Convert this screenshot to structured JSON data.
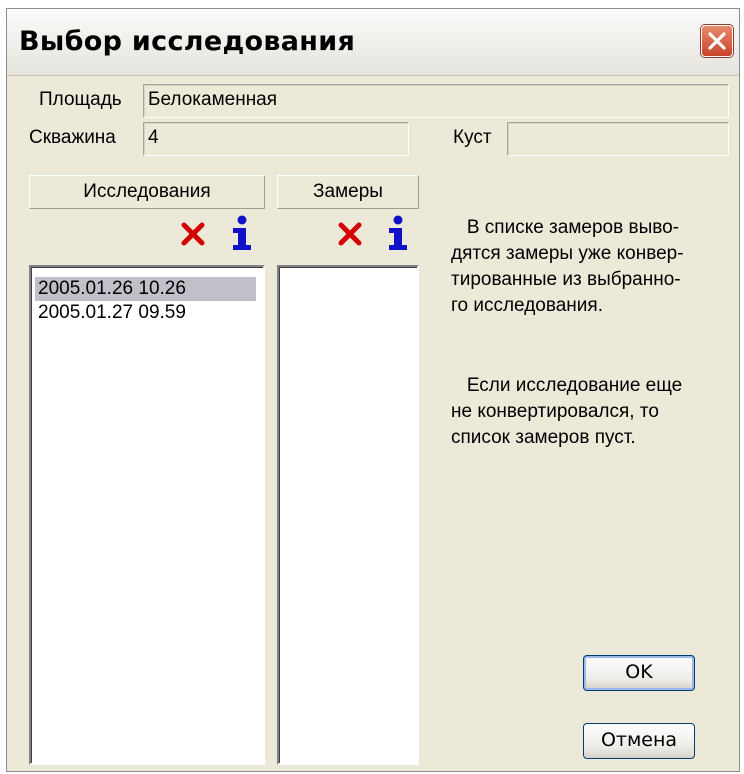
{
  "dialog": {
    "title": "Выбор исследования"
  },
  "fields": {
    "area_label": "Площадь",
    "area_value": "Белокаменная",
    "well_label": "Скважина",
    "well_value": "4",
    "cluster_label": "Куст",
    "cluster_value": ""
  },
  "studies": {
    "header": "Исследования",
    "items": [
      "2005.01.26 10.26",
      "2005.01.27 09.59"
    ],
    "selected_index": 0
  },
  "measurements": {
    "header": "Замеры",
    "items": []
  },
  "help": {
    "paragraph1": "   В списке замеров выво-\nдятся замеры уже конвер-\nтированные из выбранно-\nго исследования.",
    "paragraph2": "   Если исследование еще\nне конвертировался, то\nсписок замеров пуст."
  },
  "buttons": {
    "ok": "OK",
    "cancel": "Отмена"
  },
  "icons": {
    "delete": "delete-x-icon",
    "info": "info-icon",
    "close": "close-icon"
  },
  "colors": {
    "delete_red": "#d40000",
    "info_blue": "#1010c8",
    "dialog_bg": "#ece9d8",
    "selection": "#c0c0c8"
  }
}
